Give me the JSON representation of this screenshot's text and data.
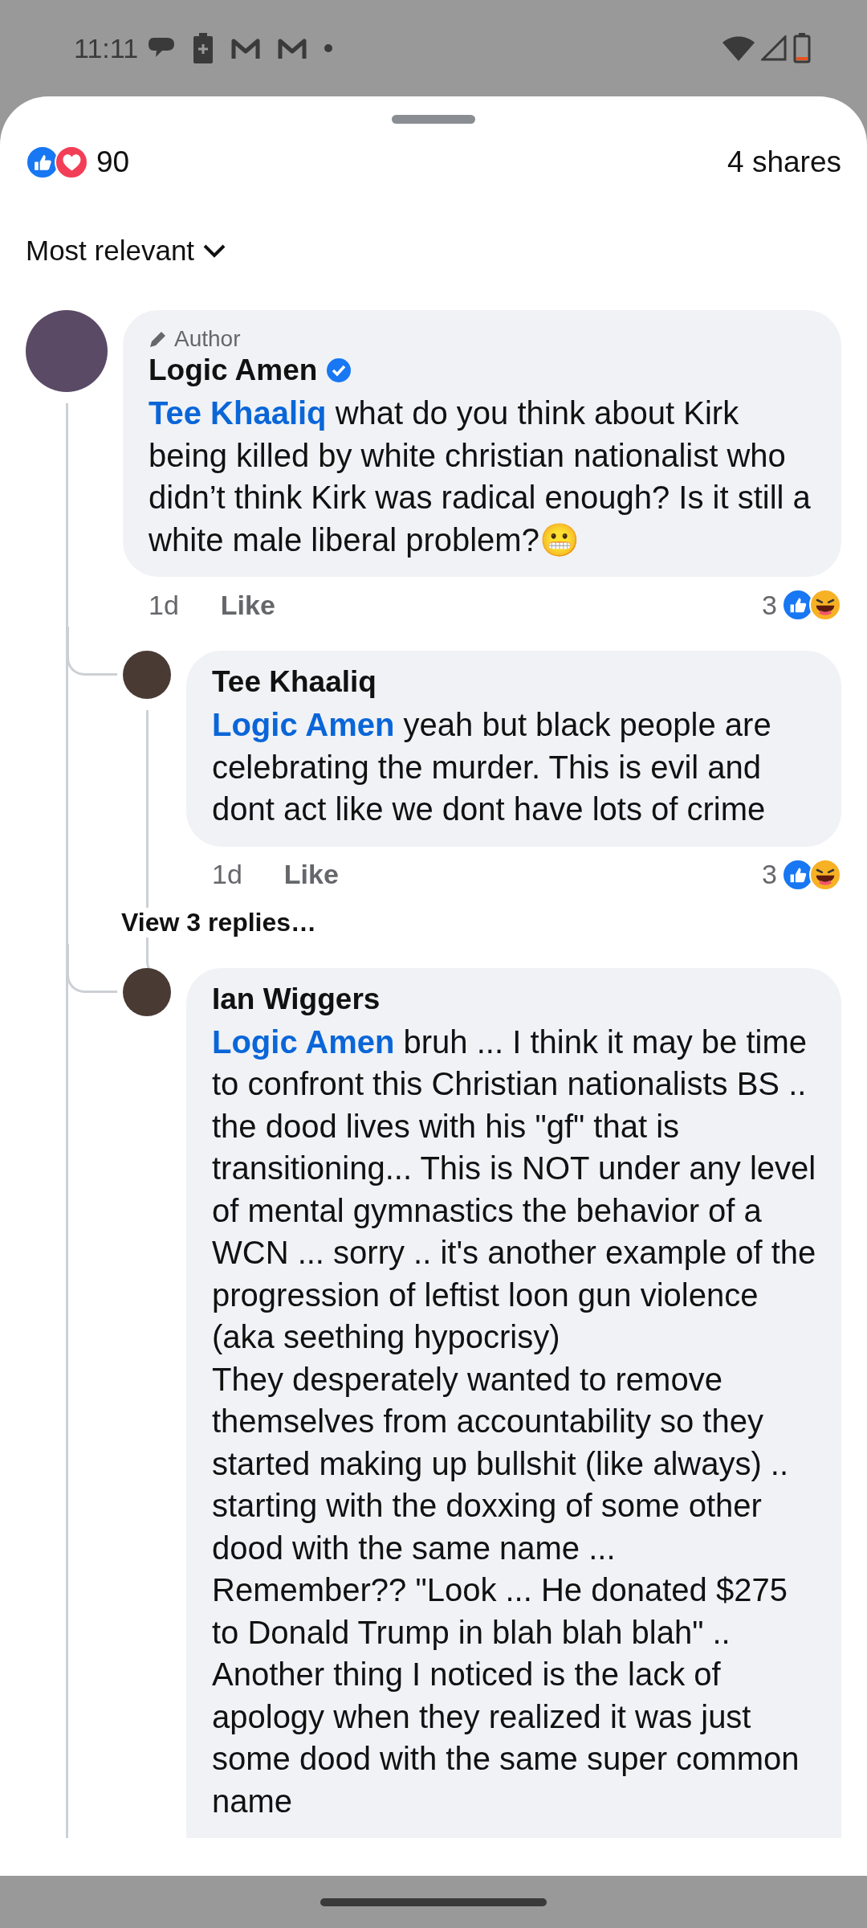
{
  "status_bar": {
    "time": "11:11"
  },
  "summary": {
    "reaction_count": "90",
    "shares": "4 shares"
  },
  "sort": {
    "label": "Most relevant"
  },
  "comments": [
    {
      "badge": "Author",
      "author": "Logic Amen",
      "verified": true,
      "mention": "Tee Khaaliq",
      "text": " what do you think about Kirk being killed by white christian nationalist who didn’t think Kirk was radical enough? Is it still a white male liberal problem?😬",
      "time": "1d",
      "like": "Like",
      "reaction_count": "3",
      "replies": [
        {
          "author": "Tee Khaaliq",
          "verified": false,
          "mention": "Logic Amen",
          "text": " yeah but black people are celebrating the murder.  This is evil and dont act like we dont have lots of crime",
          "time": "1d",
          "like": "Like",
          "reaction_count": "3",
          "view_replies": "View 3 replies…"
        },
        {
          "author": "Ian Wiggers",
          "verified": false,
          "mention": "Logic Amen",
          "text": " bruh ... I think it may be time to confront this Christian nationalists BS ..   the dood lives with his \"gf\" that is transitioning...  This is NOT under any level of mental gymnastics the behavior of a WCN ... sorry ..   it's another example of the progression of leftist loon gun violence (aka seething hypocrisy)\nThey desperately wanted to remove themselves from accountability so they started making up bullshit (like always) ..  starting with the doxxing of some other dood with the same name ... Remember?? \"Look ... He donated $275 to Donald Trump in blah blah blah\" ..\nAnother thing I noticed is the lack of apology when they realized it was just some dood with the same super common name"
        }
      ]
    }
  ]
}
